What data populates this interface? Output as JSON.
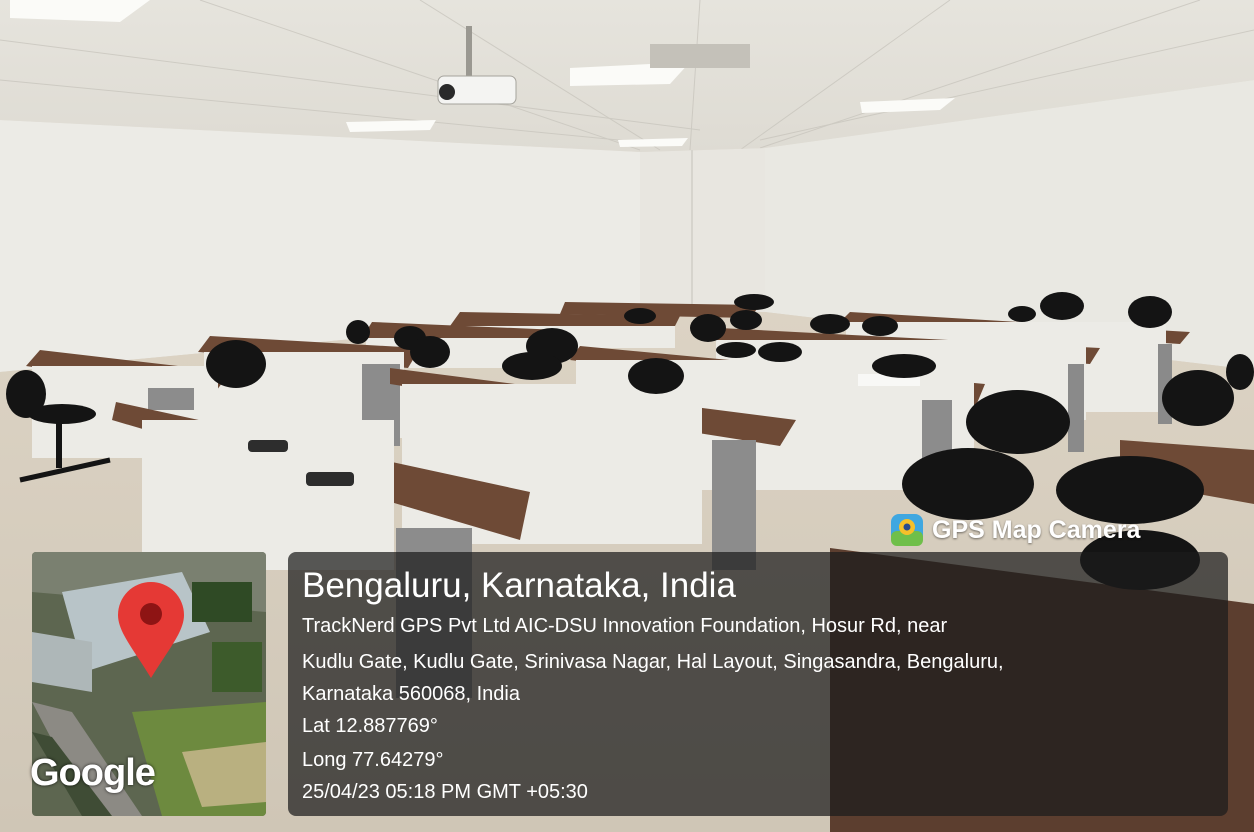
{
  "location": {
    "city_line": "Bengaluru, Karnataka, India",
    "address_lines": [
      "TrackNerd GPS Pvt Ltd AIC-DSU Innovation Foundation, Hosur Rd, near",
      "Kudlu Gate, Kudlu Gate, Srinivasa Nagar, Hal Layout, Singasandra, Bengaluru,",
      "Karnataka 560068, India"
    ],
    "latitude": "Lat 12.887769°",
    "longitude": "Long 77.64279°",
    "timestamp": "25/04/23 05:18 PM GMT +05:30"
  },
  "branding": {
    "app_name": "GPS Map Camera",
    "map_provider": "Google"
  },
  "icons": {
    "pin": "map-pin-icon",
    "app": "camera-app-icon"
  },
  "colors": {
    "pin_red": "#e53935",
    "desk_top": "#6e4a36",
    "wall": "#ecebe6",
    "chair": "#141414"
  }
}
